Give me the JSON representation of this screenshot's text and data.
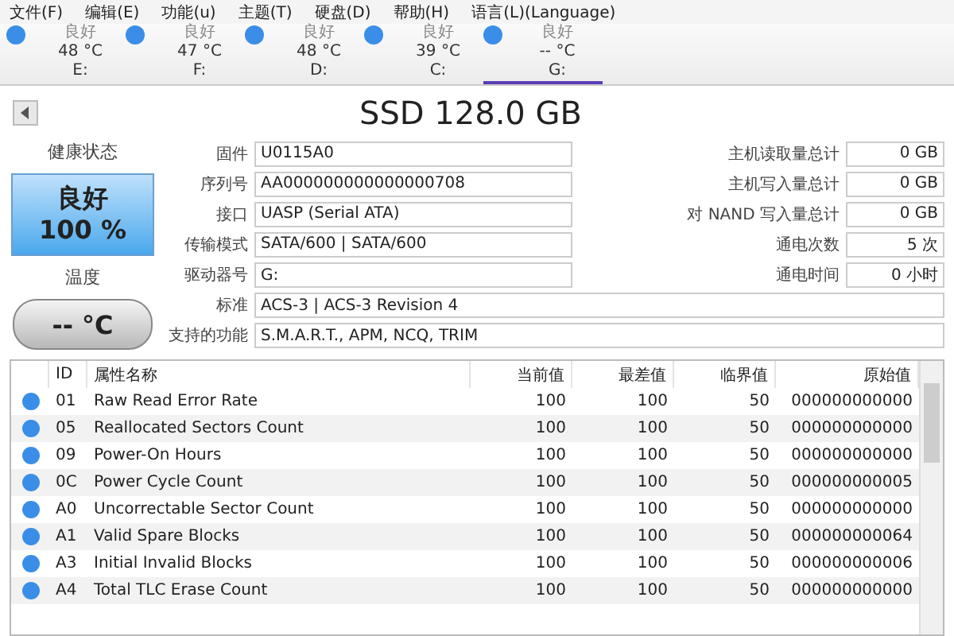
{
  "menu": [
    "文件(F)",
    "编辑(E)",
    "功能(u)",
    "主题(T)",
    "硬盘(D)",
    "帮助(H)",
    "语言(L)(Language)"
  ],
  "drives": [
    {
      "status": "良好",
      "temp": "48 °C",
      "letter": "E:",
      "color": "#3a8ee8",
      "selected": false
    },
    {
      "status": "良好",
      "temp": "47 °C",
      "letter": "F:",
      "color": "#3a8ee8",
      "selected": false
    },
    {
      "status": "良好",
      "temp": "48 °C",
      "letter": "D:",
      "color": "#3a8ee8",
      "selected": false
    },
    {
      "status": "良好",
      "temp": "39 °C",
      "letter": "C:",
      "color": "#3a8ee8",
      "selected": false
    },
    {
      "status": "良好",
      "temp": "-- °C",
      "letter": "G:",
      "color": "#3a8ee8",
      "selected": true
    }
  ],
  "title": "SSD 128.0 GB",
  "health": {
    "label": "健康状态",
    "status": "良好",
    "percent": "100 %",
    "color": "#4aa8ec"
  },
  "temperature": {
    "label": "温度",
    "value": "-- °C"
  },
  "info_left": [
    {
      "label": "固件",
      "value": "U0115A0"
    },
    {
      "label": "序列号",
      "value": "AA000000000000000708"
    },
    {
      "label": "接口",
      "value": "UASP (Serial ATA)"
    },
    {
      "label": "传输模式",
      "value": "SATA/600 | SATA/600"
    },
    {
      "label": "驱动器号",
      "value": "G:"
    }
  ],
  "info_right": [
    {
      "label": "主机读取量总计",
      "value": "0 GB"
    },
    {
      "label": "主机写入量总计",
      "value": "0 GB"
    },
    {
      "label": "对 NAND 写入量总计",
      "value": "0 GB"
    },
    {
      "label": "通电次数",
      "value": "5 次"
    },
    {
      "label": "通电时间",
      "value": "0 小时"
    }
  ],
  "info_wide": [
    {
      "label": "标准",
      "value": "ACS-3 | ACS-3 Revision 4"
    },
    {
      "label": "支持的功能",
      "value": "S.M.A.R.T., APM, NCQ, TRIM"
    }
  ],
  "table": {
    "columns": [
      "ID",
      "属性名称",
      "当前值",
      "最差值",
      "临界值",
      "原始值"
    ],
    "rows": [
      {
        "color": "#3a8ee8",
        "cells": [
          "01",
          "Raw Read Error Rate",
          "100",
          "100",
          "50",
          "000000000000"
        ]
      },
      {
        "color": "#3a8ee8",
        "cells": [
          "05",
          "Reallocated Sectors Count",
          "100",
          "100",
          "50",
          "000000000000"
        ]
      },
      {
        "color": "#3a8ee8",
        "cells": [
          "09",
          "Power-On Hours",
          "100",
          "100",
          "50",
          "000000000000"
        ]
      },
      {
        "color": "#3a8ee8",
        "cells": [
          "0C",
          "Power Cycle Count",
          "100",
          "100",
          "50",
          "000000000005"
        ]
      },
      {
        "color": "#3a8ee8",
        "cells": [
          "A0",
          "Uncorrectable Sector Count",
          "100",
          "100",
          "50",
          "000000000000"
        ]
      },
      {
        "color": "#3a8ee8",
        "cells": [
          "A1",
          "Valid Spare Blocks",
          "100",
          "100",
          "50",
          "000000000064"
        ]
      },
      {
        "color": "#3a8ee8",
        "cells": [
          "A3",
          "Initial Invalid Blocks",
          "100",
          "100",
          "50",
          "000000000006"
        ]
      },
      {
        "color": "#3a8ee8",
        "cells": [
          "A4",
          "Total TLC Erase Count",
          "100",
          "100",
          "50",
          "000000000000"
        ]
      }
    ]
  }
}
